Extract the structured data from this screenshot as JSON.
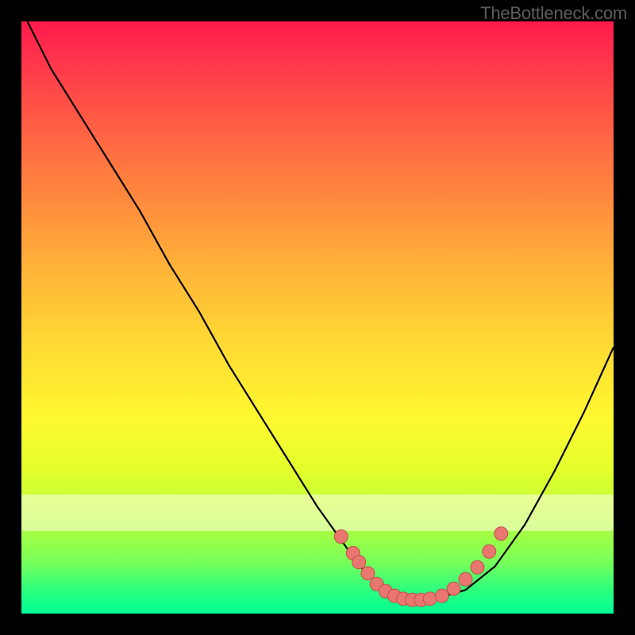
{
  "attribution": "TheBottleneck.com",
  "colors": {
    "background": "#000000",
    "curve": "#000000",
    "marker_fill": "#e9766f",
    "marker_stroke": "#c24f4a"
  },
  "chart_data": {
    "type": "line",
    "title": "",
    "xlabel": "",
    "ylabel": "",
    "xlim": [
      0,
      100
    ],
    "ylim": [
      0,
      100
    ],
    "series": [
      {
        "name": "bottleneck-curve",
        "x": [
          1,
          5,
          10,
          15,
          20,
          25,
          30,
          35,
          40,
          45,
          50,
          55,
          58,
          60,
          63,
          66,
          70,
          75,
          80,
          85,
          90,
          95,
          100
        ],
        "values": [
          100,
          92,
          84,
          76,
          68,
          59,
          51,
          42,
          34,
          26,
          18,
          11,
          7,
          5,
          3,
          2.3,
          2.5,
          4,
          8,
          15,
          24,
          34,
          45
        ]
      }
    ],
    "markers": {
      "name": "dotted-region",
      "x": [
        54,
        56,
        57,
        58.5,
        60,
        61.5,
        63,
        64.5,
        66,
        67.5,
        69,
        71,
        73,
        75,
        77,
        79,
        81
      ],
      "values": [
        13,
        10.2,
        8.7,
        6.8,
        5.0,
        3.8,
        3.0,
        2.5,
        2.3,
        2.3,
        2.5,
        3.0,
        4.2,
        5.8,
        7.8,
        10.5,
        13.5
      ]
    }
  }
}
